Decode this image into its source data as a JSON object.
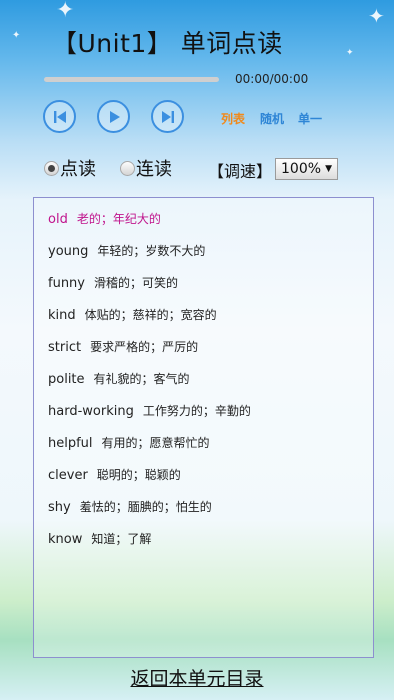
{
  "header": {
    "title": "【Unit1】 单词点读"
  },
  "player": {
    "progress": 0,
    "time_readout": "00:00/00:00",
    "prev_icon": "skip-back-icon",
    "play_icon": "play-icon",
    "next_icon": "skip-forward-icon",
    "modes": {
      "list": "列表",
      "random": "随机",
      "single": "单一"
    }
  },
  "read_mode": {
    "point_read": "点读",
    "continuous_read": "连读",
    "selected": "point_read"
  },
  "speed": {
    "label": "【调速】",
    "value": "100%"
  },
  "words": [
    {
      "word": "old",
      "meaning": "老的；年纪大的"
    },
    {
      "word": "young",
      "meaning": "年轻的；岁数不大的"
    },
    {
      "word": "funny",
      "meaning": "滑稽的；可笑的"
    },
    {
      "word": "kind",
      "meaning": "体贴的；慈祥的；宽容的"
    },
    {
      "word": "strict",
      "meaning": "要求严格的；严厉的"
    },
    {
      "word": "polite",
      "meaning": "有礼貌的；客气的"
    },
    {
      "word": "hard-working",
      "meaning": "工作努力的；辛勤的"
    },
    {
      "word": "helpful",
      "meaning": "有用的；愿意帮忙的"
    },
    {
      "word": "clever",
      "meaning": "聪明的；聪颖的"
    },
    {
      "word": "shy",
      "meaning": "羞怯的；腼腆的；怕生的"
    },
    {
      "word": "know",
      "meaning": "知道；了解"
    }
  ],
  "colors": {
    "accent_blue": "#3b8fe0",
    "mode_orange": "#f08a1c",
    "mode_blue": "#2f86d6",
    "highlight_pink": "#c0148c"
  },
  "footer": {
    "back_link": "返回本单元目录"
  }
}
